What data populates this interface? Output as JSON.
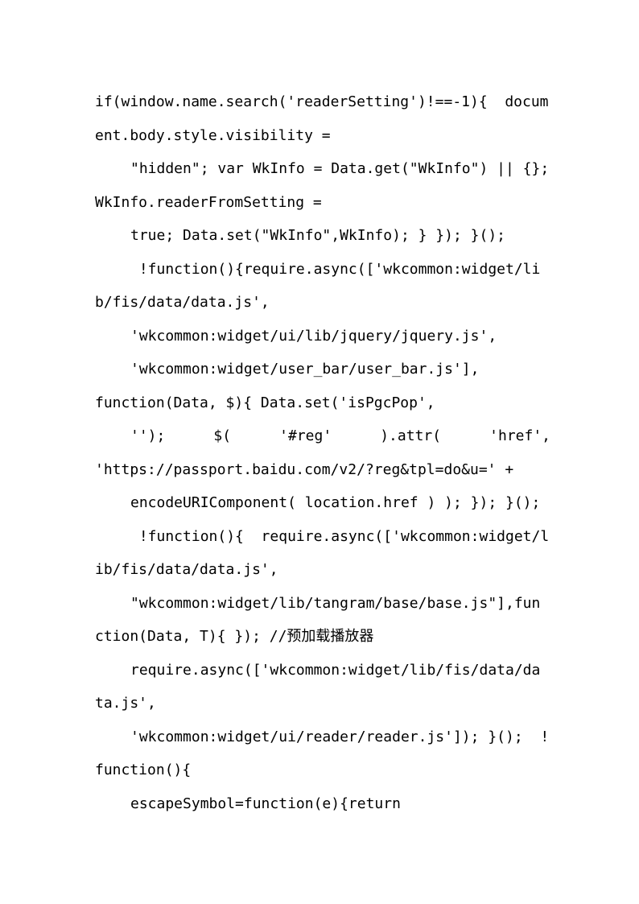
{
  "document": {
    "page_background": "#ffffff",
    "text_color": "#000000",
    "content_type": "source-code-listing",
    "language": "javascript",
    "lines": [
      {
        "text": "if(window.name.search('readerSetting')!==-1){  docum",
        "indent": false
      },
      {
        "text": "ent.body.style.visibility =",
        "indent": false
      },
      {
        "text": "\"hidden\"; var WkInfo = Data.get(\"WkInfo\") || {};",
        "indent": true
      },
      {
        "text": "WkInfo.readerFromSetting =",
        "indent": false
      },
      {
        "text": "true; Data.set(\"WkInfo\",WkInfo); } }); }();",
        "indent": true
      },
      {
        "text": " !function(){require.async(['wkcommon:widget/li",
        "indent": true
      },
      {
        "text": "b/fis/data/data.js',",
        "indent": false
      },
      {
        "text": "'wkcommon:widget/ui/lib/jquery/jquery.js',",
        "indent": true
      },
      {
        "text": "'wkcommon:widget/user_bar/user_bar.js'],",
        "indent": true
      },
      {
        "text": "function(Data, $){ Data.set('isPgcPop',",
        "indent": false
      },
      {
        "text": "''$);$$$$$$$$$(   '#reg'    ).attr(   'href',",
        "indent": true
      },
      {
        "text": "'https://passport.baidu.com/v2/?reg&tpl=do&u=' +",
        "indent": false
      },
      {
        "text": "encodeURIComponent( location.href ) ); }); }();",
        "indent": true
      },
      {
        "text": " !function(){  require.async(['wkcommon:widget/l",
        "indent": true
      },
      {
        "text": "ib/fis/data/data.js',",
        "indent": false
      },
      {
        "text": "\"wkcommon:widget/lib/tangram/base/base.js\"],fun",
        "indent": true
      },
      {
        "text": "ction(Data, T){ }); //预加载播放器",
        "indent": false
      },
      {
        "text": "require.async(['wkcommon:widget/lib/fis/data/da",
        "indent": true
      },
      {
        "text": "ta.js',",
        "indent": false
      },
      {
        "text": "'wkcommon:widget/ui/reader/reader.js']); }();  !",
        "indent": true
      },
      {
        "text": "function(){",
        "indent": false
      },
      {
        "text": "escapeSymbol=function(e){return",
        "indent": true
      }
    ],
    "justified_line": {
      "index": 10,
      "segments": [
        "''); ",
        "$( ",
        "'#reg' ",
        ").attr( ",
        "'href',"
      ]
    },
    "chinese_comment": "//预加载播放器"
  }
}
